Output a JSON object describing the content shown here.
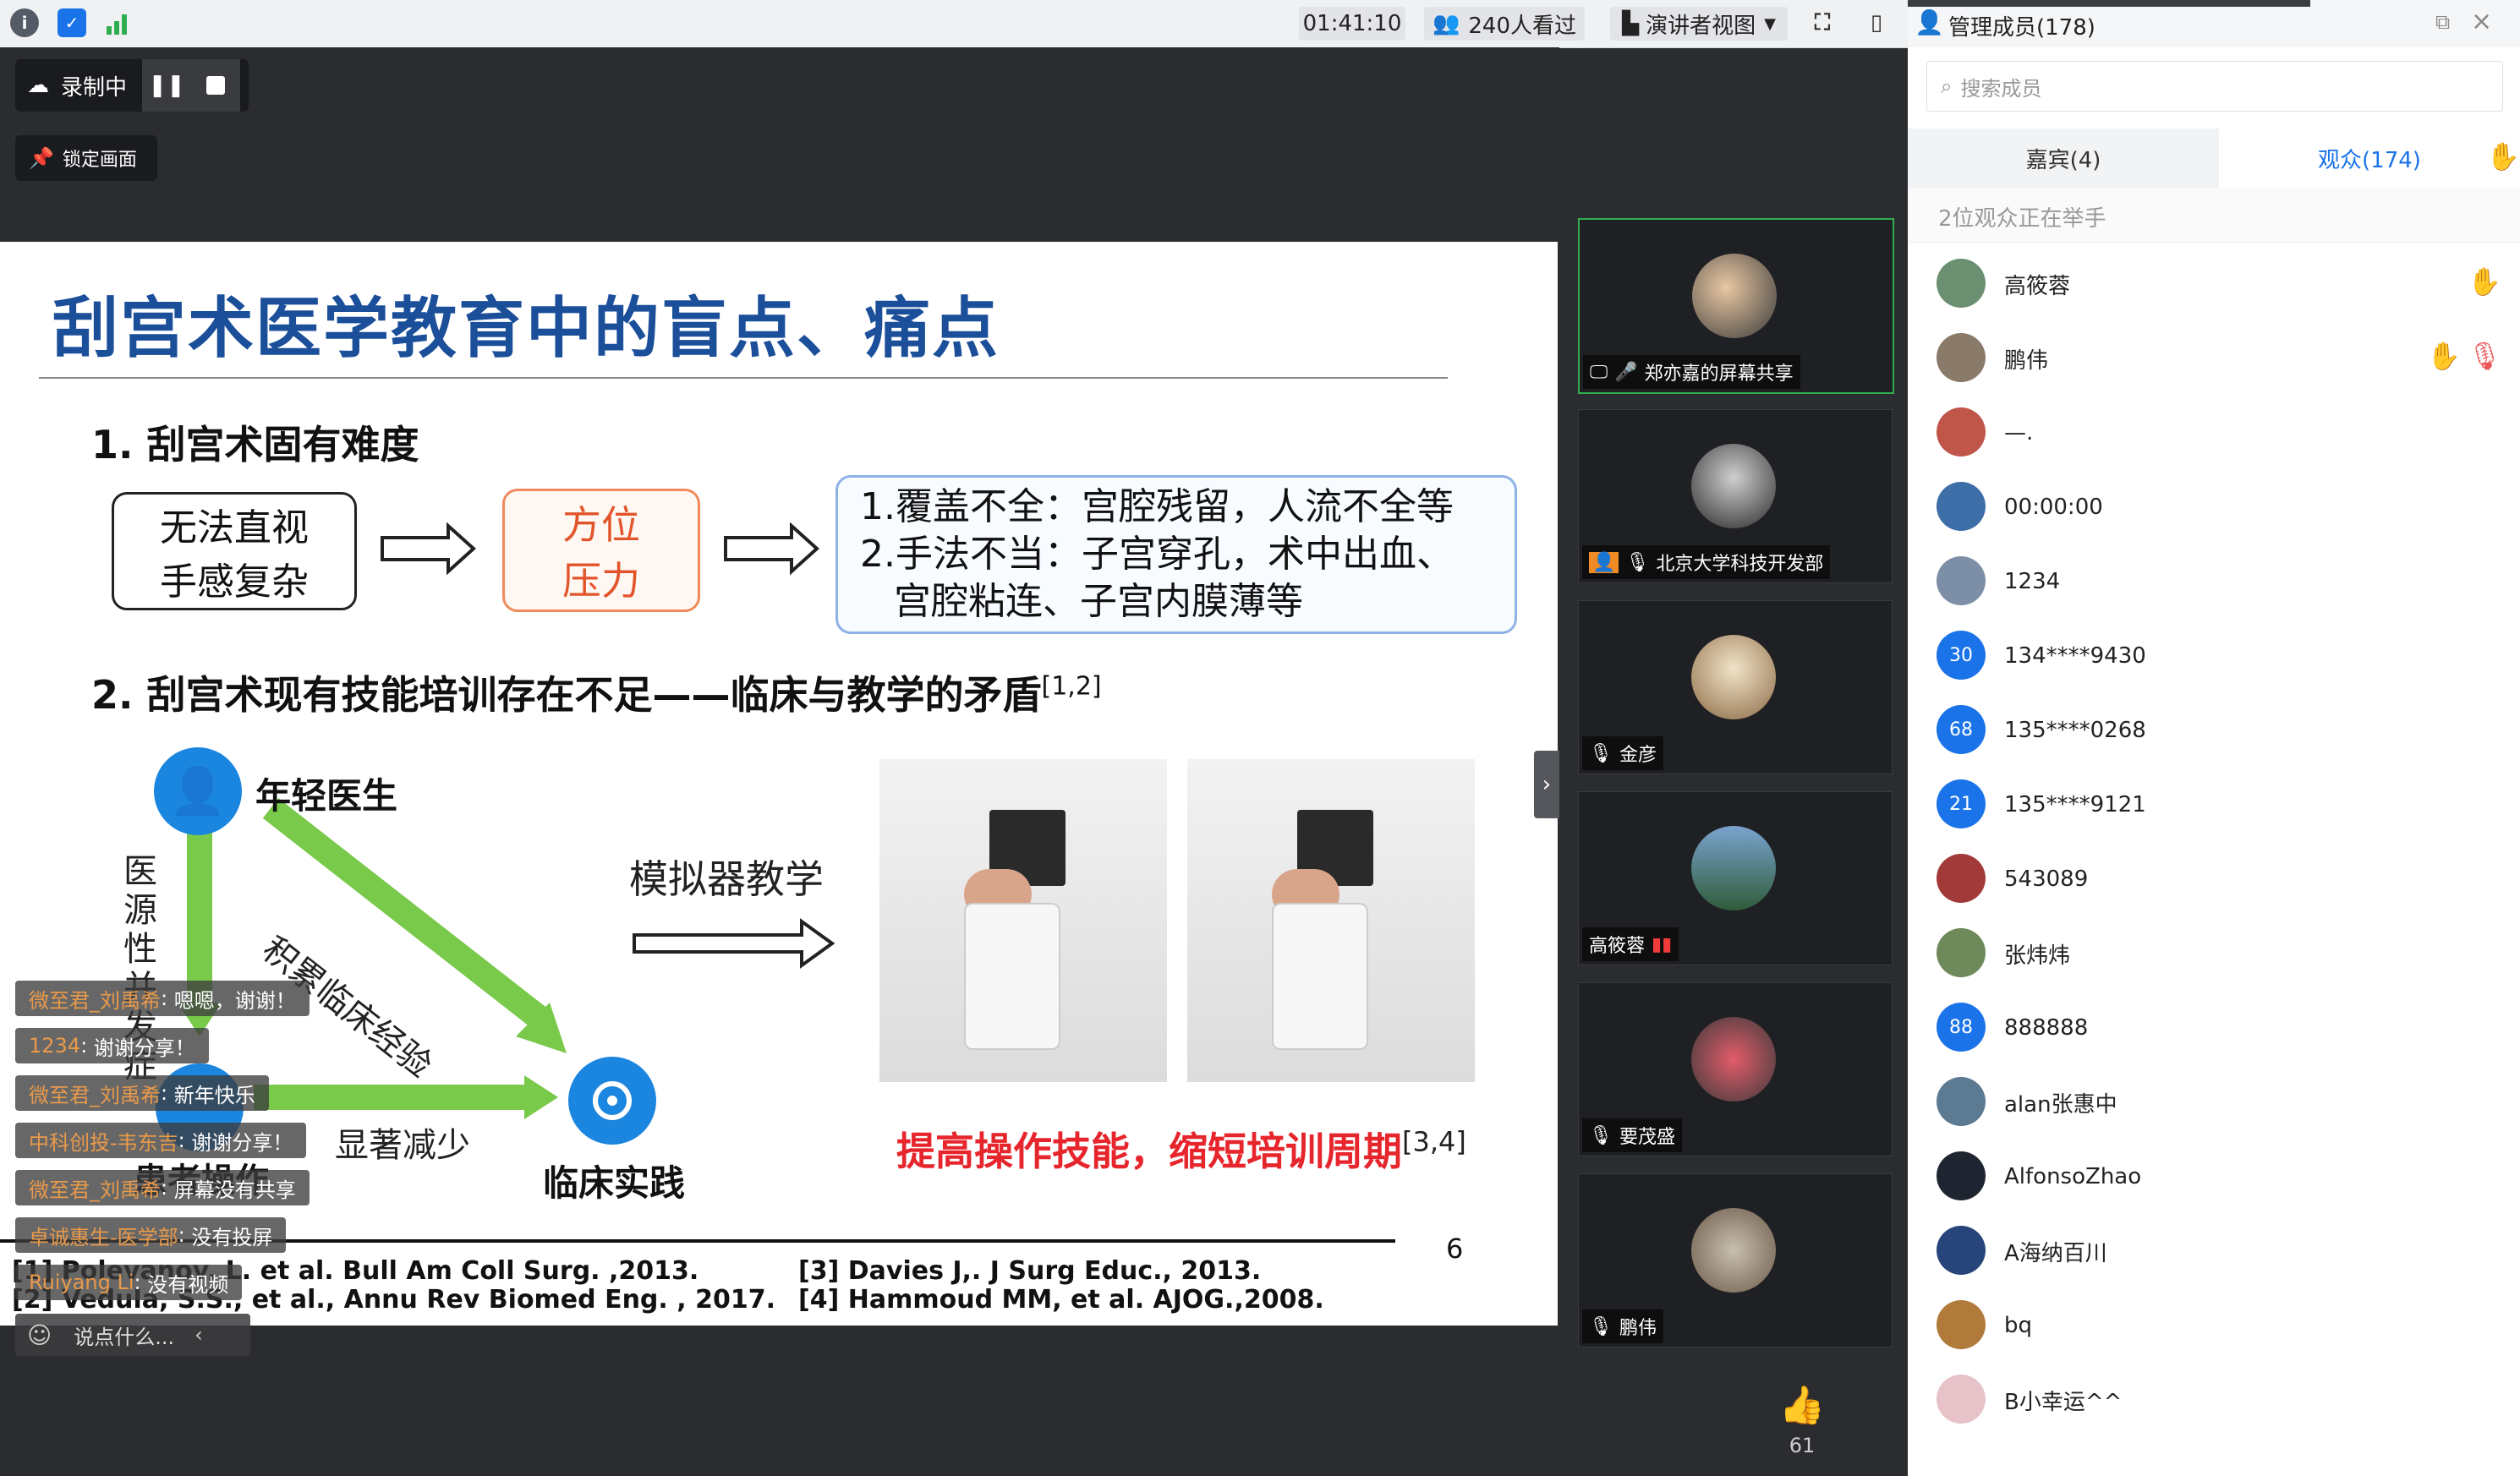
{
  "topbar": {
    "timer": "01:41:10",
    "viewers": "240人看过",
    "view_mode": "演讲者视图",
    "panel_title": "管理成员(178)"
  },
  "recording": {
    "status": "录制中",
    "lock_label": "锁定画面"
  },
  "slide": {
    "title": "刮宫术医学教育中的盲点、痛点",
    "heading1": "1. 刮宫术固有难度",
    "box1_line1": "无法直视",
    "box1_line2": "手感复杂",
    "box2_line1": "方位",
    "box2_line2": "压力",
    "box3_line1": "1.覆盖不全：宫腔残留，人流不全等",
    "box3_line2": "2.手法不当：子宫穿孔，术中出血、",
    "box3_line3": "宫腔粘连、子宫内膜薄等",
    "heading2": "2. 刮宫术现有技能培训存在不足——临床与教学的矛盾",
    "heading2_ref": "[1,2]",
    "node_young": "年轻医生",
    "node_clinical": "临床实践",
    "node_patient": "患者操作",
    "vertical_label": "医源性并发症",
    "diag_label": "积累临床经验",
    "reduce_label": "显著减少",
    "simulator_label": "模拟器教学",
    "improve": "提高操作技能，缩短培训周期",
    "improve_ref": "[3,4]",
    "page_number": "6",
    "refs": {
      "r1": "[1]  Polevanov, L. et al. Bull Am Coll Surg. ,2013.",
      "r2": "[2]  Vedula, S.S., et al., Annu Rev Biomed Eng. , 2017.",
      "r3": "[3]  Davies J,. J Surg Educ., 2013.",
      "r4": "[4]  Hammoud MM, et al. AJOG.,2008."
    }
  },
  "chat": {
    "messages": [
      {
        "name": "微至君_刘禹希",
        "msg": "嗯嗯，谢谢！"
      },
      {
        "name": "1234",
        "msg": "谢谢分享！"
      },
      {
        "name": "微至君_刘禹希",
        "msg": "新年快乐"
      },
      {
        "name": "中科创投-韦东吉",
        "msg": "谢谢分享！"
      },
      {
        "name": "微至君_刘禹希",
        "msg": "屏幕没有共享"
      },
      {
        "name": "卓诚惠生-医学部",
        "msg": "没有投屏"
      },
      {
        "name": "Ruiyang Li",
        "msg": "没有视频"
      }
    ],
    "input_placeholder": "说点什么..."
  },
  "video_tiles": [
    {
      "name": "郑亦嘉的屏幕共享"
    },
    {
      "name": "北京大学科技开发部"
    },
    {
      "name": "金彦"
    },
    {
      "name": "高筱蓉"
    },
    {
      "name": "要茂盛"
    },
    {
      "name": "鹏伟"
    }
  ],
  "likes": "61",
  "panel": {
    "search_placeholder": "搜索成员",
    "tab_guests": "嘉宾(4)",
    "tab_audience": "观众(174)",
    "raise_notice": "2位观众正在举手",
    "members": [
      {
        "name": "高筱蓉",
        "badge": "",
        "color": "#6b8f71"
      },
      {
        "name": "鹏伟",
        "badge": "",
        "color": "#8a7a6a"
      },
      {
        "name": "—.",
        "badge": "",
        "color": "#c0554a"
      },
      {
        "name": "00:00:00",
        "badge": "",
        "color": "#3d6ea8"
      },
      {
        "name": "1234",
        "badge": "",
        "color": "#7c8fa6"
      },
      {
        "name": "134****9430",
        "badge": "30",
        "color": "#1a73e8"
      },
      {
        "name": "135****0268",
        "badge": "68",
        "color": "#1a73e8"
      },
      {
        "name": "135****9121",
        "badge": "21",
        "color": "#1a73e8"
      },
      {
        "name": "543089",
        "badge": "",
        "color": "#a33a3a"
      },
      {
        "name": "张炜炜",
        "badge": "",
        "color": "#6f8a5a"
      },
      {
        "name": "888888",
        "badge": "88",
        "color": "#1a73e8"
      },
      {
        "name": "alan张惠中",
        "badge": "",
        "color": "#5d7a93"
      },
      {
        "name": "AlfonsoZhao",
        "badge": "",
        "color": "#1e2430"
      },
      {
        "name": "A海纳百川",
        "badge": "",
        "color": "#27457a"
      },
      {
        "name": "bq",
        "badge": "",
        "color": "#b07a3a"
      },
      {
        "name": "B小幸运^^",
        "badge": "",
        "color": "#e7c3c9"
      }
    ]
  }
}
